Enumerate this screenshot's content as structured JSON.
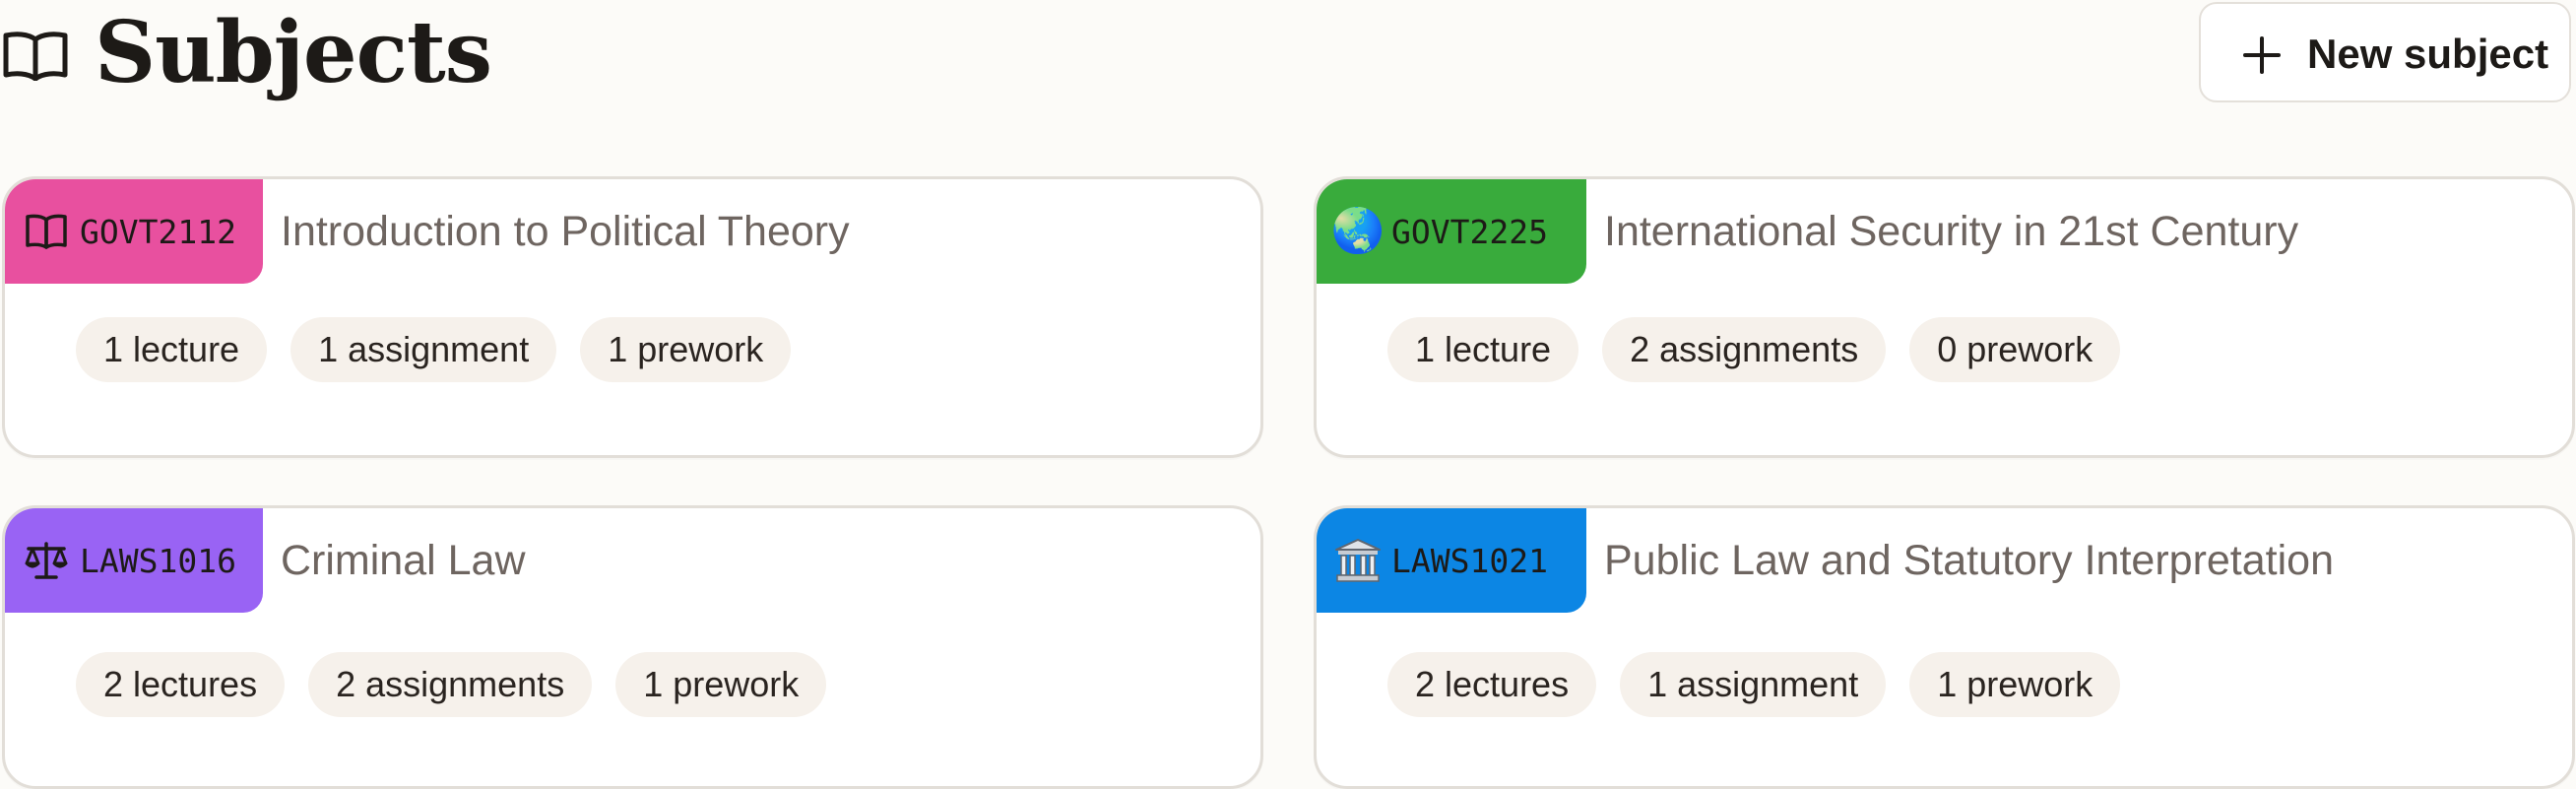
{
  "header": {
    "title": "Subjects",
    "title_icon": "open-book-icon",
    "new_button": {
      "label": "New subject",
      "icon": "plus-icon"
    }
  },
  "colors": {
    "background": "#fcfbf8",
    "chip_background": "#f6f1eb",
    "title_text": "#6e6560"
  },
  "subjects": [
    {
      "code": "GOVT2112",
      "title": "Introduction to Political Theory",
      "icon": "open-book-icon",
      "color": "#e8509f",
      "chips": [
        "1 lecture",
        "1 assignment",
        "1 prework"
      ]
    },
    {
      "code": "GOVT2225",
      "title": "International Security in 21st Century",
      "icon": "globe-icon",
      "icon_glyph": "🌏",
      "color": "#39ab3c",
      "chips": [
        "1 lecture",
        "2 assignments",
        "0 prework"
      ]
    },
    {
      "code": "LAWS1016",
      "title": "Criminal Law",
      "icon": "scales-icon",
      "color": "#9963f4",
      "chips": [
        "2 lectures",
        "2 assignments",
        "1 prework"
      ]
    },
    {
      "code": "LAWS1021",
      "title": "Public Law and Statutory Interpretation",
      "icon": "classical-building-icon",
      "color": "#0c86e4",
      "chips": [
        "2 lectures",
        "1 assignment",
        "1 prework"
      ]
    }
  ]
}
